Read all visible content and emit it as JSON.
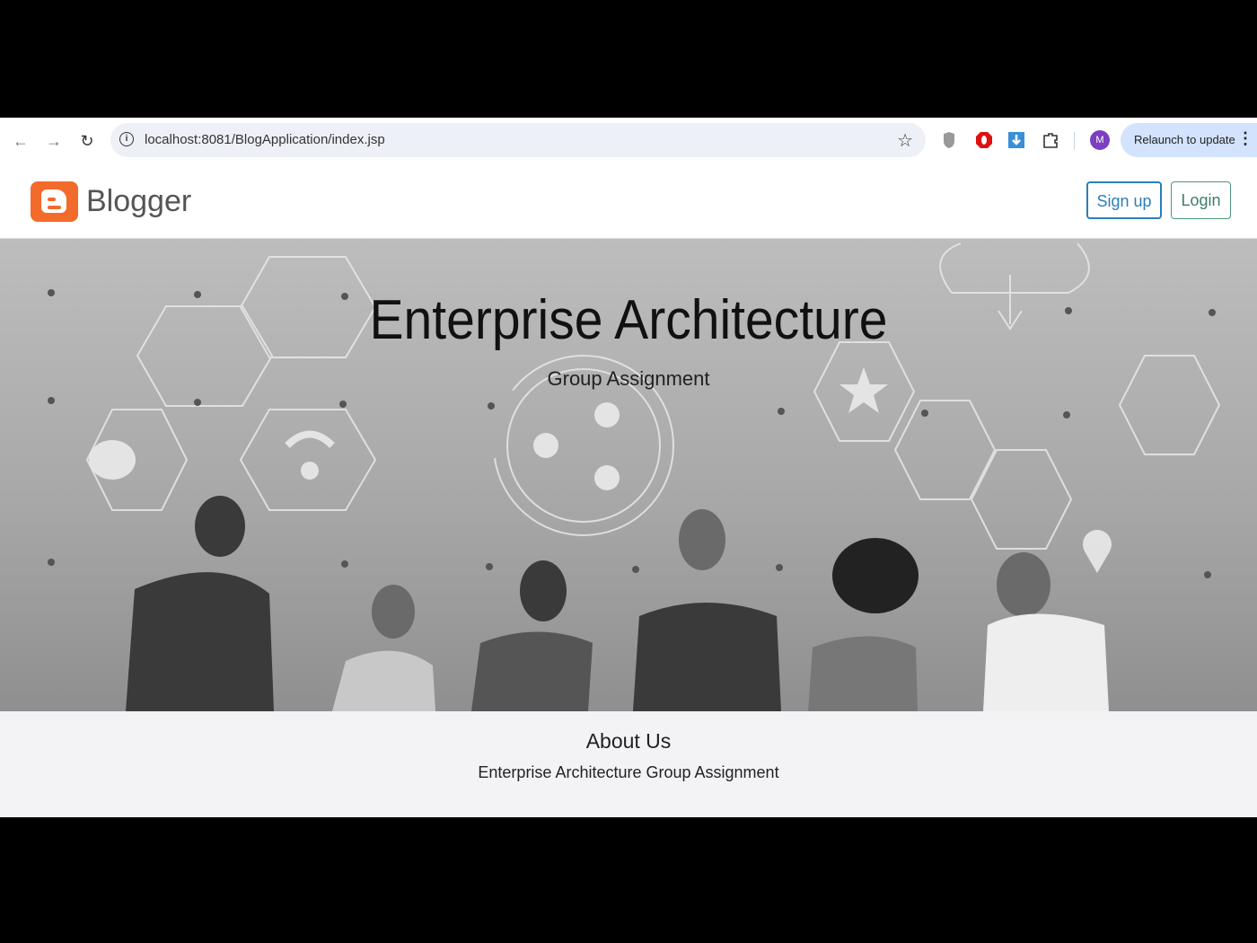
{
  "browser": {
    "url": "localhost:8081/BlogApplication/index.jsp",
    "profile_initial": "M",
    "relaunch_label": "Relaunch to update",
    "icons": [
      "back-icon",
      "forward-icon",
      "reload-icon",
      "info-icon",
      "star-icon",
      "shield-extension-icon",
      "opera-extension-icon",
      "download-extension-icon",
      "puzzle-extensions-icon",
      "kebab-menu-icon"
    ]
  },
  "header": {
    "brand": "Blogger",
    "signup_label": "Sign up",
    "login_label": "Login",
    "colors": {
      "brand": "#f26b2a",
      "signup": "#2b7fb8",
      "login": "#3d7e68"
    }
  },
  "hero": {
    "title": "Enterprise Architecture",
    "subtitle": "Group Assignment"
  },
  "about": {
    "title": "About Us",
    "text": "Enterprise Architecture Group Assignment"
  }
}
